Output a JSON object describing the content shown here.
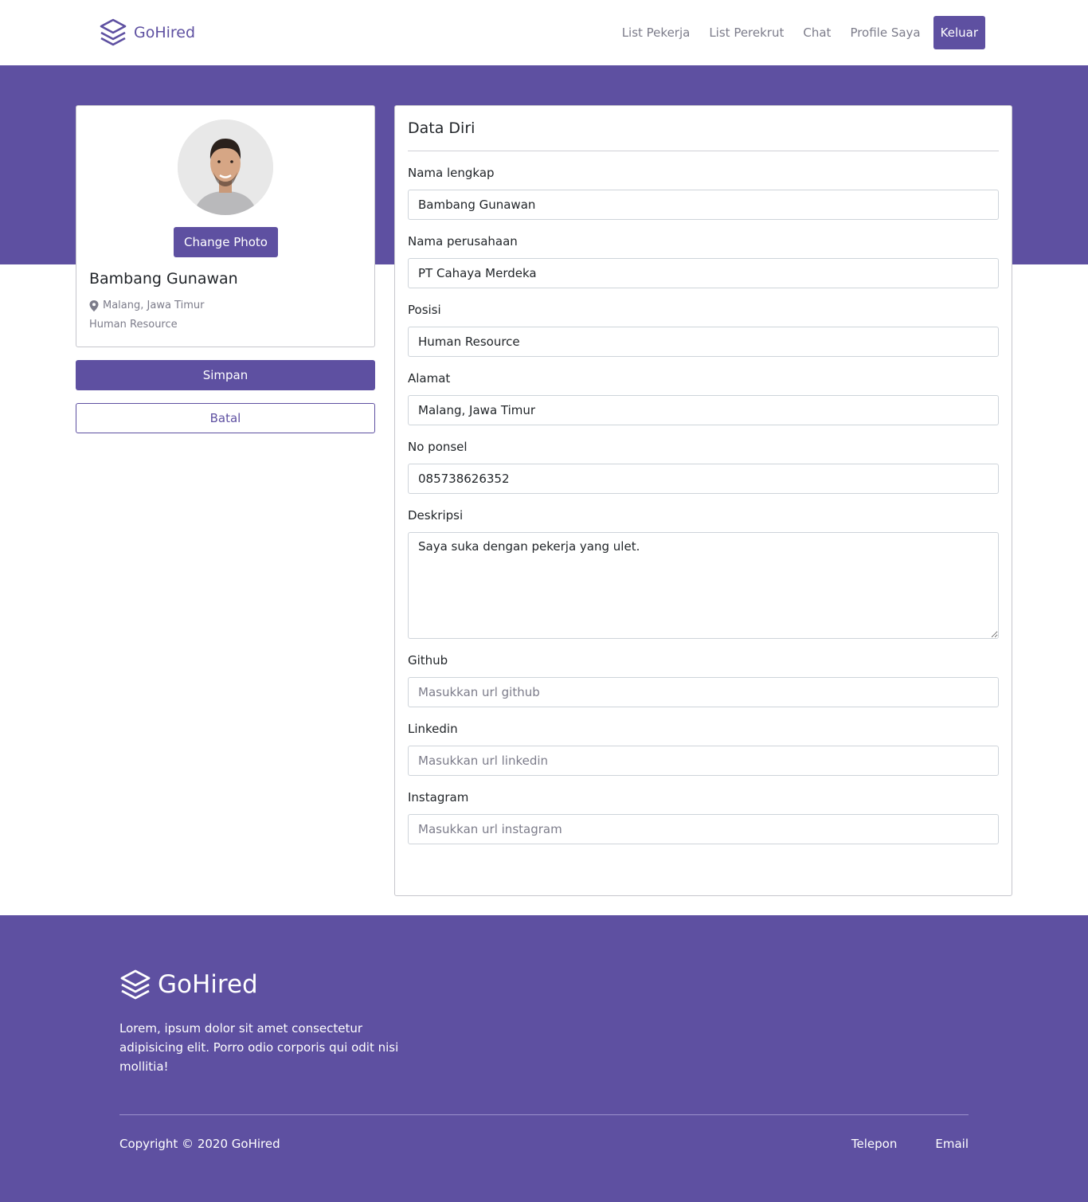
{
  "navbar": {
    "brand": "GoHired",
    "links": [
      "List Pekerja",
      "List Perekrut",
      "Chat",
      "Profile Saya"
    ],
    "logout_label": "Keluar"
  },
  "profile": {
    "change_photo_label": "Change Photo",
    "name": "Bambang Gunawan",
    "location": "Malang, Jawa Timur",
    "role": "Human Resource"
  },
  "actions": {
    "save_label": "Simpan",
    "cancel_label": "Batal"
  },
  "form": {
    "title": "Data Diri",
    "fields": [
      {
        "label": "Nama lengkap",
        "value": "Bambang Gunawan",
        "placeholder": ""
      },
      {
        "label": "Nama perusahaan",
        "value": "PT Cahaya Merdeka",
        "placeholder": ""
      },
      {
        "label": "Posisi",
        "value": "Human Resource",
        "placeholder": ""
      },
      {
        "label": "Alamat",
        "value": "Malang, Jawa Timur",
        "placeholder": ""
      },
      {
        "label": "No ponsel",
        "value": "085738626352",
        "placeholder": ""
      }
    ],
    "description": {
      "label": "Deskripsi",
      "value": "Saya suka dengan pekerja yang ulet."
    },
    "social_fields": [
      {
        "label": "Github",
        "value": "",
        "placeholder": "Masukkan url github"
      },
      {
        "label": "Linkedin",
        "value": "",
        "placeholder": "Masukkan url linkedin"
      },
      {
        "label": "Instagram",
        "value": "",
        "placeholder": "Masukkan url instagram"
      }
    ]
  },
  "footer": {
    "brand": "GoHired",
    "description": "Lorem, ipsum dolor sit amet consectetur adipisicing elit. Porro odio corporis qui odit nisi mollitia!",
    "copyright": "Copyright © 2020 GoHired",
    "links": [
      "Telepon",
      "Email"
    ]
  },
  "colors": {
    "primary": "#5e50a1"
  },
  "icons": {
    "brand": "layers-icon",
    "location": "map-pin-icon"
  }
}
